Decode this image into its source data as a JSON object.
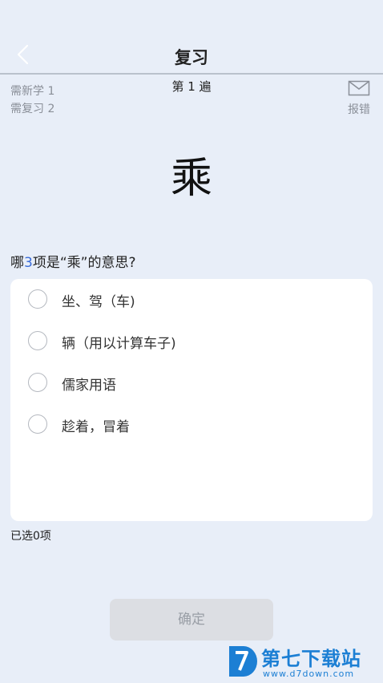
{
  "header": {
    "title": "复习"
  },
  "progress": {
    "pass_label": "第 1 遍",
    "new_to_learn": "需新学 1",
    "to_review": "需复习 2"
  },
  "report": {
    "label": "报错",
    "icon": "envelope-icon"
  },
  "word": "乘",
  "question": {
    "prefix": "哪",
    "count": "3",
    "suffix": "项是“乘”的意思?"
  },
  "options": [
    {
      "label": "坐、驾（车)",
      "selected": false
    },
    {
      "label": "辆（用以计算车子)",
      "selected": false
    },
    {
      "label": "儒家用语",
      "selected": false
    },
    {
      "label": "趁着，冒着",
      "selected": false
    }
  ],
  "selected_count": "已选0项",
  "confirm_button": "确定",
  "watermark": {
    "name": "第七下载站",
    "url": "www.d7down.com"
  },
  "colors": {
    "background": "#e8eef8",
    "accent": "#3a6cd8",
    "button_disabled": "#dcdee3",
    "watermark": "#1c7fd4"
  }
}
